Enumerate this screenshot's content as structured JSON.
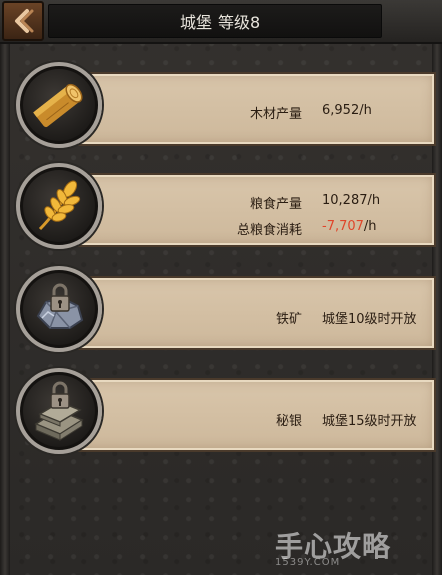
{
  "header": {
    "title": "城堡",
    "level_label": "等级8",
    "back_icon": "back-arrow-icon"
  },
  "rows": [
    {
      "icon": "wood-log-icon",
      "lines": [
        {
          "label": "木材产量",
          "value": "6,952",
          "unit": "/h",
          "negative": false
        }
      ]
    },
    {
      "icon": "grain-icon",
      "lines": [
        {
          "label": "粮食产量",
          "value": "10,287",
          "unit": "/h",
          "negative": false
        },
        {
          "label": "总粮食消耗",
          "value": "-7,707",
          "unit": "/h",
          "negative": true
        }
      ]
    },
    {
      "icon": "locked-iron-ore-icon",
      "lines": [
        {
          "label": "铁矿",
          "value": "城堡10级时开放",
          "unit": "",
          "negative": false
        }
      ]
    },
    {
      "icon": "locked-mithril-icon",
      "lines": [
        {
          "label": "秘银",
          "value": "城堡15级时开放",
          "unit": "",
          "negative": false
        }
      ]
    }
  ],
  "colors": {
    "negative": "#e0452a",
    "panel": "#d9c6ab",
    "background": "#2f2d2b"
  },
  "watermark": {
    "main": "手心攻略",
    "sub": "1539Y.COM"
  }
}
